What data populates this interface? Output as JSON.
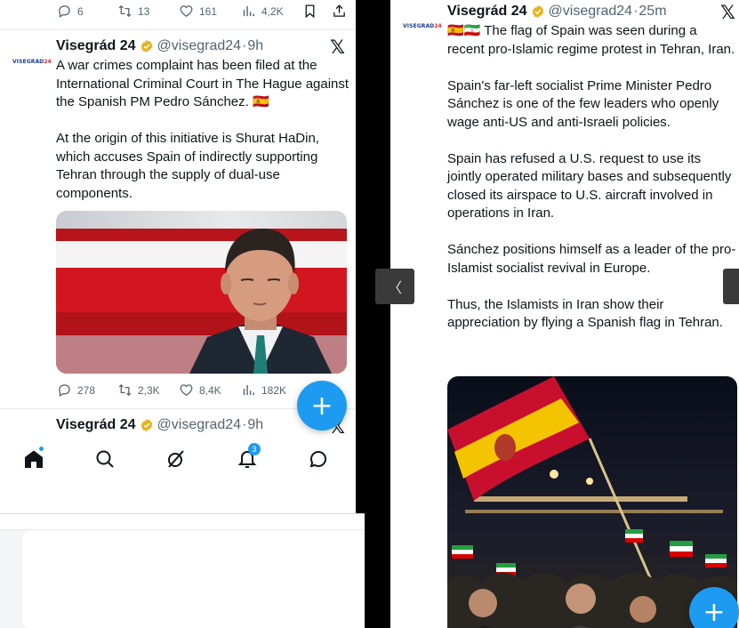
{
  "left": {
    "top_actions": {
      "replies": "6",
      "reposts": "13",
      "likes": "161",
      "views": "4,2K"
    },
    "tweet1": {
      "logo_main": "VISEGRAD",
      "logo_accent": "24",
      "name": "Visegrád 24",
      "handle": "@visegrad24",
      "separator": "·",
      "time": "9h",
      "x_icon": "𝕏",
      "text": "A war crimes complaint has been filed at the International Criminal Court in The Hague against the Spanish PM Pedro Sánchez. 🇪🇸\n\nAt the origin of this initiative is Shurat HaDin, which accuses Spain of indirectly supporting Tehran through the supply of dual-use components.",
      "actions": {
        "replies": "278",
        "reposts": "2,3K",
        "likes": "8,4K",
        "views": "182K"
      }
    },
    "tweet2": {
      "name": "Visegrád 24",
      "handle": "@visegrad24",
      "separator": "·",
      "time": "9h",
      "x_icon": "𝕏"
    },
    "fab_label": "+",
    "nav": {
      "notification_count": "3"
    }
  },
  "right": {
    "tweet": {
      "logo_main": "VISEGRAD",
      "logo_accent": "24",
      "name": "Visegrád 24",
      "handle": "@visegrad24",
      "separator": "·",
      "time": "25m",
      "x_icon": "𝕏",
      "text": "🇪🇸🇮🇷 The flag of Spain was seen during a recent pro-Islamic regime protest in Tehran, Iran.\n\nSpain's far-left socialist Prime Minister Pedro Sánchez is one of the few leaders who openly wage anti-US and anti-Israeli policies.\n\nSpain has refused a U.S. request to use its jointly operated military bases and subsequently closed its airspace to U.S. aircraft involved in operations in Iran.\n\nSánchez positions himself as a leader of the pro-Islamist socialist revival in Europe.\n\nThus, the Islamists in Iran show their appreciation by flying a Spanish flag in Tehran."
    },
    "fab_label": "+",
    "prev_arrow": "〈"
  },
  "colors": {
    "accent": "#1d9bf0",
    "verified": "#e8b21b",
    "muted": "#536471"
  }
}
